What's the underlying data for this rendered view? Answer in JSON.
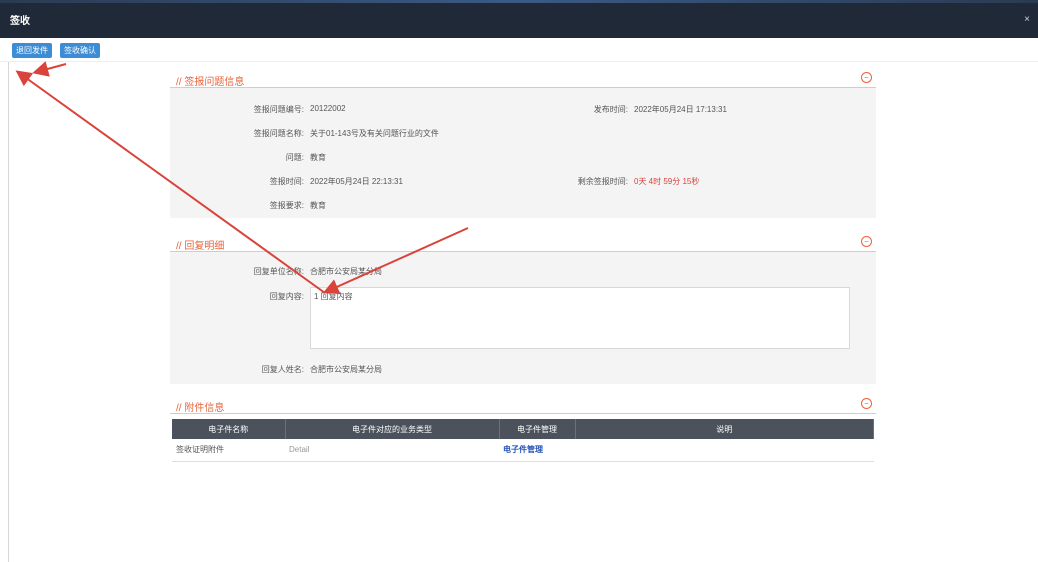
{
  "window": {
    "title": "签收",
    "close_label": "×"
  },
  "toolbar": {
    "btn1_label": "退回发件",
    "btn2_label": "签收确认"
  },
  "section1": {
    "title": "// 签报问题信息",
    "fields": [
      {
        "label": "签报问题编号:",
        "value": "20122002"
      },
      {
        "label": "签报问题名称:",
        "value": "关于01-143号及有关问题行业的文件"
      },
      {
        "label": "问题:",
        "value": "教育"
      },
      {
        "label": "签报时间:",
        "value": "2022年05月24日 22:13:31"
      },
      {
        "label": "签报要求:",
        "value": "教育"
      }
    ],
    "right_fields": [
      {
        "label": "发布时间:",
        "value": "2022年05月24日 17:13:31"
      },
      {
        "label": "剩余签报时间:",
        "value": "0天 4时 59分 15秒"
      }
    ]
  },
  "section2": {
    "title": "// 回复明细",
    "fields": [
      {
        "label": "回复单位名称:",
        "value": "合肥市公安局某分局"
      },
      {
        "label": "回复内容:",
        "value": "1 回复内容"
      },
      {
        "label": "回复人姓名:",
        "value": "合肥市公安局某分局"
      }
    ]
  },
  "section3": {
    "title": "// 附件信息",
    "columns": [
      "电子件名称",
      "电子件对应的业务类型",
      "电子件管理",
      "说明"
    ],
    "rows": [
      {
        "name": "签收证明附件",
        "type": "Detail",
        "manage": "电子件管理",
        "desc": ""
      }
    ]
  },
  "icons": {
    "collapse": "minus-circle-icon",
    "close": "close-icon"
  },
  "colors": {
    "accent": "#e8643a",
    "button": "#3d8dd6",
    "topbar": "#1f2937",
    "table_header": "#4b525b",
    "arrow": "#d9433a"
  }
}
